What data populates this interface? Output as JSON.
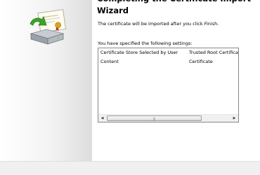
{
  "wizard": {
    "title": "Completing the Certificate Import Wizard",
    "subtitle": "The certificate will be imported after you click Finish.",
    "settings_label": "You have specified the following settings:",
    "settings": [
      {
        "name": "Certificate Store Selected by User",
        "value": "Trusted Root Certification Authorities"
      },
      {
        "name": "Content",
        "value": "Certificate"
      }
    ]
  },
  "scrollbar": {
    "left_arrow": "◀",
    "right_arrow": "▶",
    "grip": "|||"
  },
  "icons": {
    "sidebar": "certificate-import-icon"
  },
  "colors": {
    "content_background": "#ffffff",
    "sidebar_background": "#f0f0f0",
    "list_border": "#828790",
    "green_arrow": "#3aa626"
  }
}
